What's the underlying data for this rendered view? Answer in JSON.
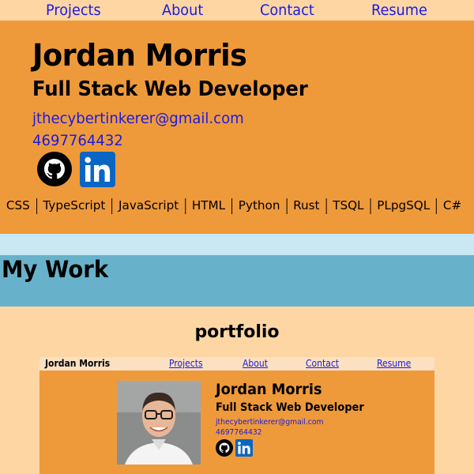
{
  "nav": {
    "links": [
      "Projects",
      "About",
      "Contact",
      "Resume"
    ]
  },
  "hero": {
    "name": "Jordan Morris",
    "role": "Full Stack Web Developer",
    "email": "jthecybertinkerer@gmail.com",
    "phone": "4697764432",
    "icons": [
      "github-icon",
      "linkedin-icon"
    ]
  },
  "skills": [
    "CSS",
    "TypeScript",
    "JavaScript",
    "HTML",
    "Python",
    "Rust",
    "TSQL",
    "PLpgSQL",
    "C#"
  ],
  "work": {
    "heading": "My Work"
  },
  "portfolio": {
    "title": "portfolio",
    "preview": {
      "brand": "Jordan Morris",
      "links": [
        "Projects",
        "About",
        "Contact",
        "Resume"
      ],
      "name": "Jordan Morris",
      "role": "Full Stack Web Developer",
      "email": "jthecybertinkerer@gmail.com",
      "phone": "4697764432"
    }
  },
  "colors": {
    "hero_bg": "#ef9a3a",
    "page_bg": "#fdd6a4",
    "band_light": "#c9e8f4",
    "band_dark": "#67b2ca",
    "link": "#1a1ae6",
    "linkedin": "#0a66c2"
  }
}
